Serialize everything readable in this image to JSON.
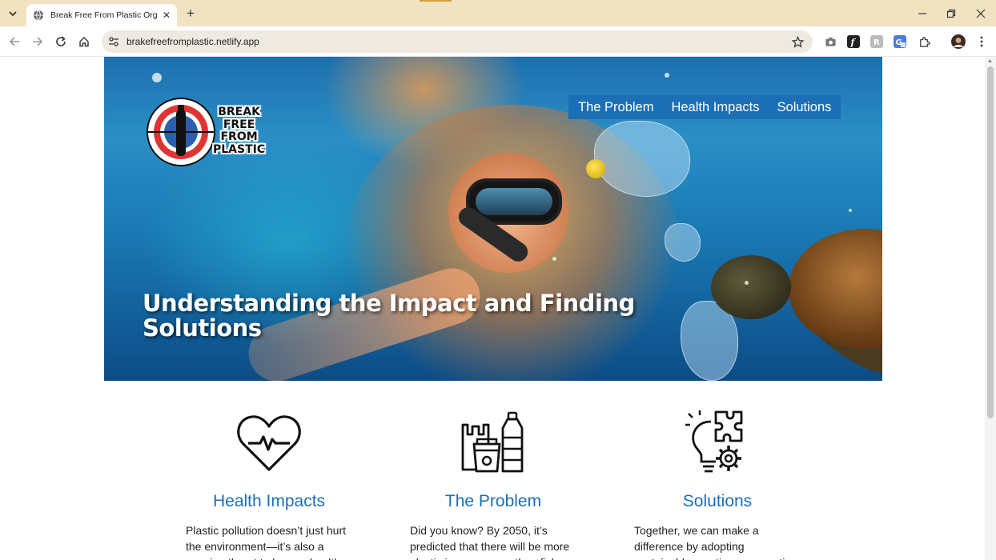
{
  "browser": {
    "tab_title": "Break Free From Plastic Org",
    "url": "brakefreefromplastic.netlify.app",
    "new_tab_label": "+",
    "close_tab_label": "✕"
  },
  "site": {
    "logo_text": [
      "BREAK",
      "FREE",
      "FROM",
      "PLASTIC"
    ],
    "nav": [
      "The Problem",
      "Health Impacts",
      "Solutions"
    ],
    "hero_title": "Understanding the Impact and Finding Solutions"
  },
  "features": [
    {
      "icon": "heartbeat-icon",
      "title": "Health Impacts",
      "text": "Plastic pollution doesn’t just hurt the environment—it’s also a growing threat to human health."
    },
    {
      "icon": "plastic-items-icon",
      "title": "The Problem",
      "text": "Did you know? By 2050, it’s predicted that there will be more plastic in our oceans than fish. The"
    },
    {
      "icon": "idea-puzzle-gear-icon",
      "title": "Solutions",
      "text": "Together, we can make a difference by adopting sustainable practices, supporting innovative solutions"
    }
  ],
  "colors": {
    "accent": "#1c6fb5",
    "tabbar": "#f1e3c1",
    "omnibox": "#efeae1"
  }
}
